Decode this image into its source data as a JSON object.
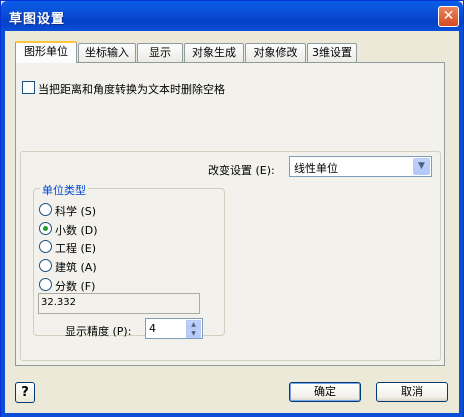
{
  "window": {
    "title": "草图设置",
    "close_symbol": "✕"
  },
  "tabs": [
    {
      "label": "图形单位",
      "active": true
    },
    {
      "label": "坐标输入",
      "active": false
    },
    {
      "label": "显示",
      "active": false
    },
    {
      "label": "对象生成",
      "active": false
    },
    {
      "label": "对象修改",
      "active": false
    },
    {
      "label": "3维设置",
      "active": false
    }
  ],
  "options": {
    "remove_spaces_label": "当把距离和角度转换为文本时删除空格",
    "remove_spaces_checked": false
  },
  "change_setting": {
    "label": "改变设置 (E):",
    "value": "线性单位"
  },
  "unit_type": {
    "legend": "单位类型",
    "options": [
      {
        "label": "科学 (S)",
        "selected": false
      },
      {
        "label": "小数 (D)",
        "selected": true
      },
      {
        "label": "工程 (E)",
        "selected": false
      },
      {
        "label": "建筑 (A)",
        "selected": false
      },
      {
        "label": "分数 (F)",
        "selected": false
      }
    ],
    "sample": "32.332"
  },
  "precision": {
    "label": "显示精度 (P):",
    "value": "4"
  },
  "buttons": {
    "help": "?",
    "ok": "确定",
    "cancel": "取消"
  },
  "colors": {
    "title_bar": "#0a4fd6",
    "close_button": "#d44a21",
    "legend_text": "#0046d5",
    "radio_dot": "#21a121"
  },
  "icons": {
    "close": "close-icon",
    "dropdown": "chevron-down-icon",
    "spin_up": "spin-up-icon",
    "spin_down": "spin-down-icon"
  }
}
